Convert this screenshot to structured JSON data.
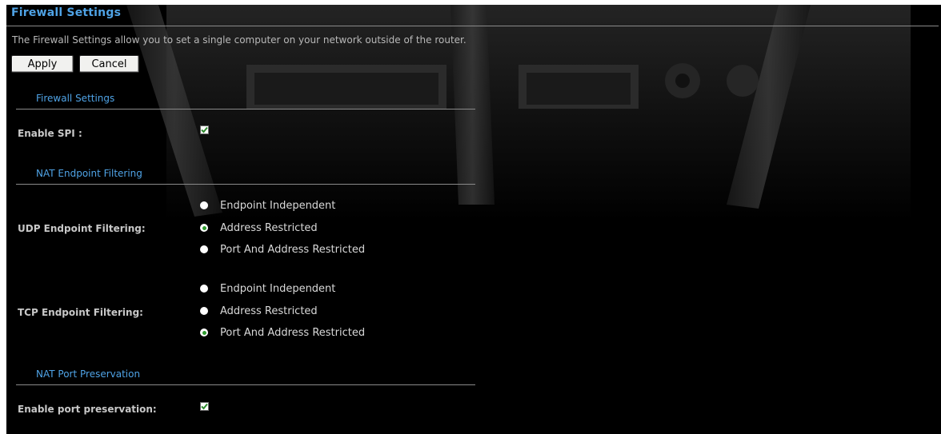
{
  "page": {
    "title": "Firewall Settings",
    "description": "The Firewall Settings allow you to set a single computer on your network outside of the router."
  },
  "buttons": {
    "apply": "Apply",
    "cancel": "Cancel"
  },
  "sections": {
    "firewall": {
      "heading": "Firewall Settings",
      "spi": {
        "label": "Enable SPI :",
        "checked": true
      }
    },
    "nat_filtering": {
      "heading": "NAT Endpoint Filtering",
      "udp": {
        "label": "UDP Endpoint Filtering:",
        "options": [
          "Endpoint Independent",
          "Address Restricted",
          "Port And Address Restricted"
        ],
        "selected": "Address Restricted"
      },
      "tcp": {
        "label": "TCP Endpoint Filtering:",
        "options": [
          "Endpoint Independent",
          "Address Restricted",
          "Port And Address Restricted"
        ],
        "selected": "Port And Address Restricted"
      }
    },
    "port_preservation": {
      "heading": "NAT Port Preservation",
      "enable": {
        "label": "Enable port preservation:",
        "checked": true
      }
    }
  },
  "colors": {
    "accent": "#4fa3e6",
    "background": "#000000",
    "radio_selected": "#2e9a2e",
    "check": "#2e8b2e"
  },
  "icons": {
    "checkmark": "checkmark-icon"
  }
}
